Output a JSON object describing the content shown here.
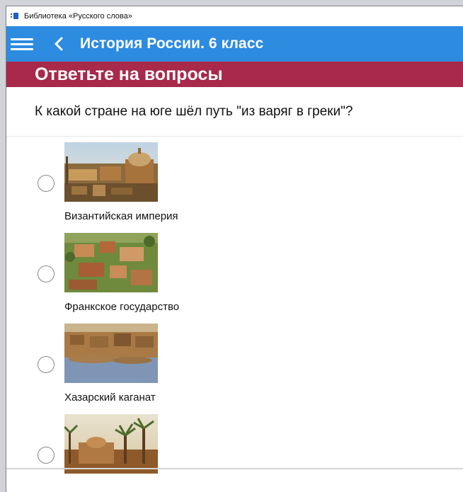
{
  "window": {
    "title": "Библиотека «Русского слова»"
  },
  "appbar": {
    "title": "История России. 6 класс"
  },
  "section": {
    "header": "Ответьте на вопросы"
  },
  "question": {
    "text": "К какой стране на юге шёл путь \"из варяг в греки\"?"
  },
  "answers": [
    {
      "label": "Византийская империя",
      "image": "byzantine-city-painting"
    },
    {
      "label": "Франкское государство",
      "image": "frankish-town-aerial"
    },
    {
      "label": "Хазарский каганат",
      "image": "khazar-fortress-model"
    },
    {
      "label": "",
      "image": "arab-caliphate-palms-painting"
    }
  ],
  "colors": {
    "appbar": "#2d8be0",
    "section_header": "#a8294a"
  }
}
